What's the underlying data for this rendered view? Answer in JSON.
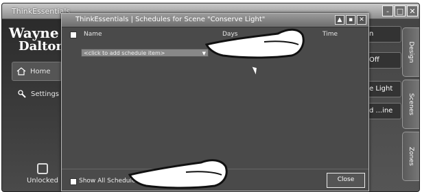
{
  "app": {
    "title": "ThinkEssentials",
    "window_buttons": [
      "-",
      "□",
      "✕"
    ],
    "logo_line1": "Wayne",
    "logo_line2": "Dalton"
  },
  "left_nav": {
    "home_label": "Home",
    "settings_label": "Settings",
    "lock_label": "Unlocked"
  },
  "right_pane": {
    "buttons": [
      "n",
      "Off",
      "e Light",
      "d ...ine"
    ],
    "tabs": [
      "Design",
      "Scenes",
      "Zones"
    ]
  },
  "dialog": {
    "title": "ThinkEssentials | Schedules for Scene \"Conserve Light\"",
    "title_buttons": [
      "▲",
      "▪",
      "✕"
    ],
    "columns": {
      "name": "Name",
      "days": "Days",
      "time": "Time"
    },
    "add_item_placeholder": "<click to add schedule item>",
    "show_all_label": "Show All Schedules",
    "close_label": "Close"
  },
  "colors": {
    "frame_bg": "#3a3a3a",
    "dialog_bg": "#4a4a4a",
    "dropdown_bg": "#888888",
    "accent": "#ffffff"
  },
  "icons": [
    "home-icon",
    "settings-icon",
    "lock-icon",
    "pointing-hand-icon"
  ]
}
